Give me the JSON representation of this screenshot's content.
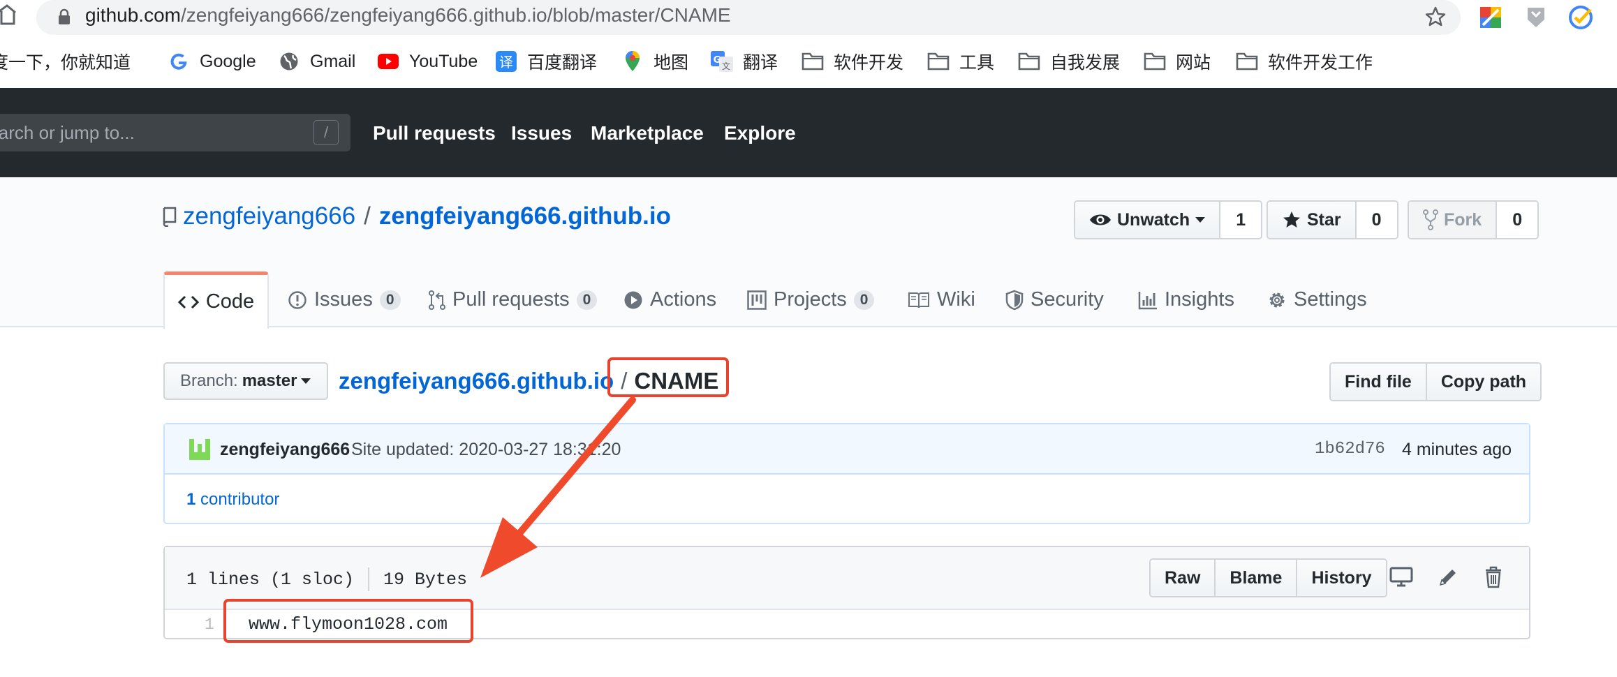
{
  "browser": {
    "url_host": "github.com",
    "url_path": "/zengfeiyang666/zengfeiyang666.github.io/blob/master/CNAME",
    "bookmarks": [
      {
        "label": "百度一下，你就知道",
        "icon": "baidu-icon"
      },
      {
        "label": "Google",
        "icon": "google-icon"
      },
      {
        "label": "Gmail",
        "icon": "globe-icon"
      },
      {
        "label": "YouTube",
        "icon": "youtube-icon"
      },
      {
        "label": "百度翻译",
        "icon": "baidu-translate-icon"
      },
      {
        "label": "地图",
        "icon": "maps-icon"
      },
      {
        "label": "翻译",
        "icon": "google-translate-icon"
      },
      {
        "label": "软件开发",
        "icon": "folder-icon"
      },
      {
        "label": "工具",
        "icon": "folder-icon"
      },
      {
        "label": "自我发展",
        "icon": "folder-icon"
      },
      {
        "label": "网站",
        "icon": "folder-icon"
      },
      {
        "label": "软件开发工作",
        "icon": "folder-icon"
      }
    ]
  },
  "header": {
    "search_placeholder": "Search or jump to...",
    "slash_hint": "/",
    "nav": [
      "Pull requests",
      "Issues",
      "Marketplace",
      "Explore"
    ]
  },
  "repo": {
    "owner": "zengfeiyang666",
    "separator": "/",
    "name": "zengfeiyang666.github.io",
    "unwatch_label": "Unwatch",
    "watch_count": "1",
    "star_label": "Star",
    "star_count": "0",
    "fork_label": "Fork",
    "fork_count": "0"
  },
  "tabs": [
    {
      "label": "Code",
      "count": null,
      "icon": "code-icon"
    },
    {
      "label": "Issues",
      "count": "0",
      "icon": "issue-icon"
    },
    {
      "label": "Pull requests",
      "count": "0",
      "icon": "pull-request-icon"
    },
    {
      "label": "Actions",
      "count": null,
      "icon": "play-icon"
    },
    {
      "label": "Projects",
      "count": "0",
      "icon": "project-icon"
    },
    {
      "label": "Wiki",
      "count": null,
      "icon": "book-icon"
    },
    {
      "label": "Security",
      "count": null,
      "icon": "shield-icon"
    },
    {
      "label": "Insights",
      "count": null,
      "icon": "graph-icon"
    },
    {
      "label": "Settings",
      "count": null,
      "icon": "gear-icon"
    }
  ],
  "file_nav": {
    "branch_prefix": "Branch:",
    "branch_name": "master",
    "root": "zengfeiyang666.github.io",
    "separator": "/",
    "file": "CNAME",
    "find_file": "Find file",
    "copy_path": "Copy path"
  },
  "commit": {
    "author": "zengfeiyang666",
    "message": "Site updated: 2020-03-27 18:31:20",
    "sha": "1b62d76",
    "time": "4 minutes ago",
    "contributors": "1 contributor",
    "contributors_count": "1",
    "contributors_word": "contributor"
  },
  "file": {
    "lines": "1 lines (1 sloc)",
    "size": "19 Bytes",
    "raw": "Raw",
    "blame": "Blame",
    "history": "History",
    "line_number": "1",
    "content": "www.flymoon1028.com"
  },
  "annotation": {
    "color": "#e8432e"
  }
}
